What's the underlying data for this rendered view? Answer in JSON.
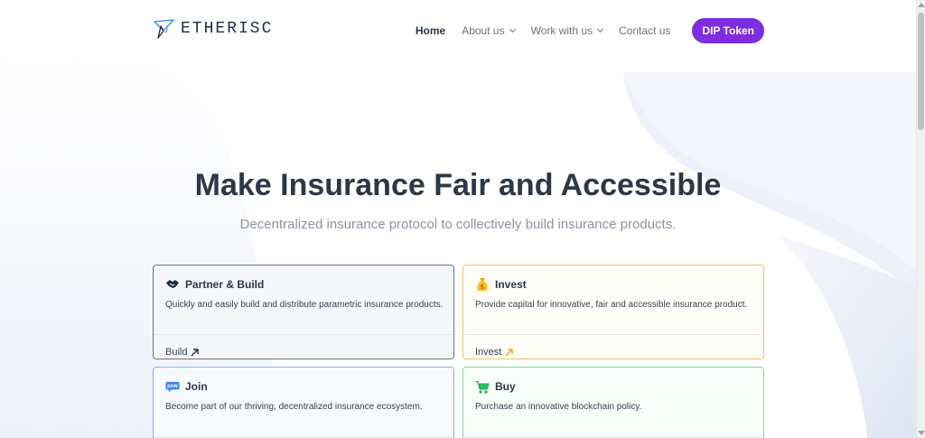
{
  "header": {
    "logo_text": "ETHERISC",
    "nav": [
      {
        "label": "Home",
        "active": true,
        "dropdown": false
      },
      {
        "label": "About us",
        "active": false,
        "dropdown": true
      },
      {
        "label": "Work with us",
        "active": false,
        "dropdown": true
      },
      {
        "label": "Contact us",
        "active": false,
        "dropdown": false
      }
    ],
    "cta_label": "DIP Token"
  },
  "hero": {
    "title": "Make Insurance Fair and Accessible",
    "subtitle": "Decentralized insurance protocol to collectively build insurance products."
  },
  "cards": [
    {
      "icon": "handshake-icon",
      "title": "Partner & Build",
      "description": "Quickly and easily build and distribute parametric insurance products.",
      "link": "Build",
      "accent": "#6b7280"
    },
    {
      "icon": "money-bag-icon",
      "title": "Invest",
      "description": "Provide capital for innovative, fair and accessible insurance product.",
      "link": "Invest",
      "accent": "#f6c365"
    },
    {
      "icon": "join-badge-icon",
      "icon_text": "JOIN",
      "title": "Join",
      "description": "Become part of our thriving, decentralized insurance ecosystem.",
      "link": "",
      "accent": "#8ab0ea"
    },
    {
      "icon": "cart-icon",
      "title": "Buy",
      "description": "Purchase an innovative blockchain policy.",
      "link": "",
      "accent": "#7fdca4"
    }
  ],
  "colors": {
    "brand_purple": "#7c2ee0",
    "text_dark": "#2d3748",
    "text_muted": "#8b93a1"
  }
}
